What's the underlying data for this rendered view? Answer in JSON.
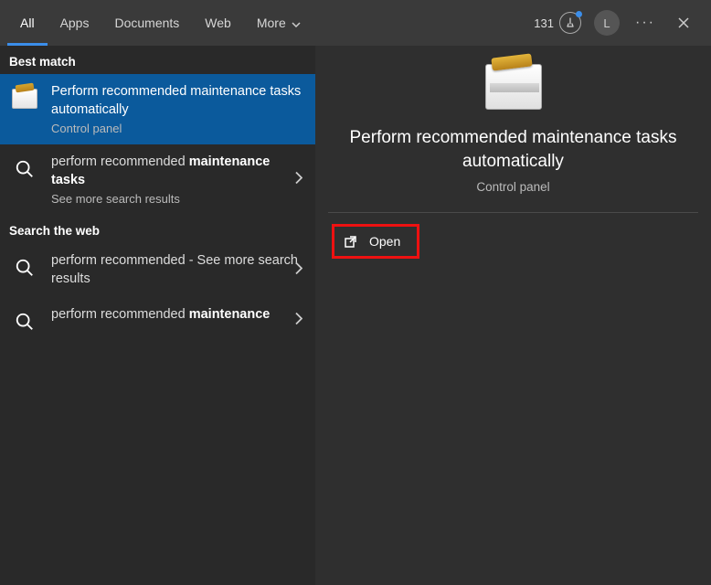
{
  "header": {
    "tabs": {
      "all": "All",
      "apps": "Apps",
      "documents": "Documents",
      "web": "Web",
      "more": "More"
    },
    "rewards_count": "131",
    "avatar_initial": "L"
  },
  "left": {
    "best_match_label": "Best match",
    "best_match": {
      "title": "Perform recommended maintenance tasks automatically",
      "subtitle": "Control panel"
    },
    "result_maintenance_tasks": {
      "title_light": "perform recommended",
      "title_bold": "maintenance tasks",
      "subtitle": "See more search results"
    },
    "web_label": "Search the web",
    "web_result_1": {
      "prefix": "perform recommended",
      "suffix": " - See more search results"
    },
    "web_result_2": {
      "prefix": "perform recommended ",
      "bold": "maintenance"
    }
  },
  "preview": {
    "title": "Perform recommended maintenance tasks automatically",
    "subtitle": "Control panel",
    "open_label": "Open"
  }
}
